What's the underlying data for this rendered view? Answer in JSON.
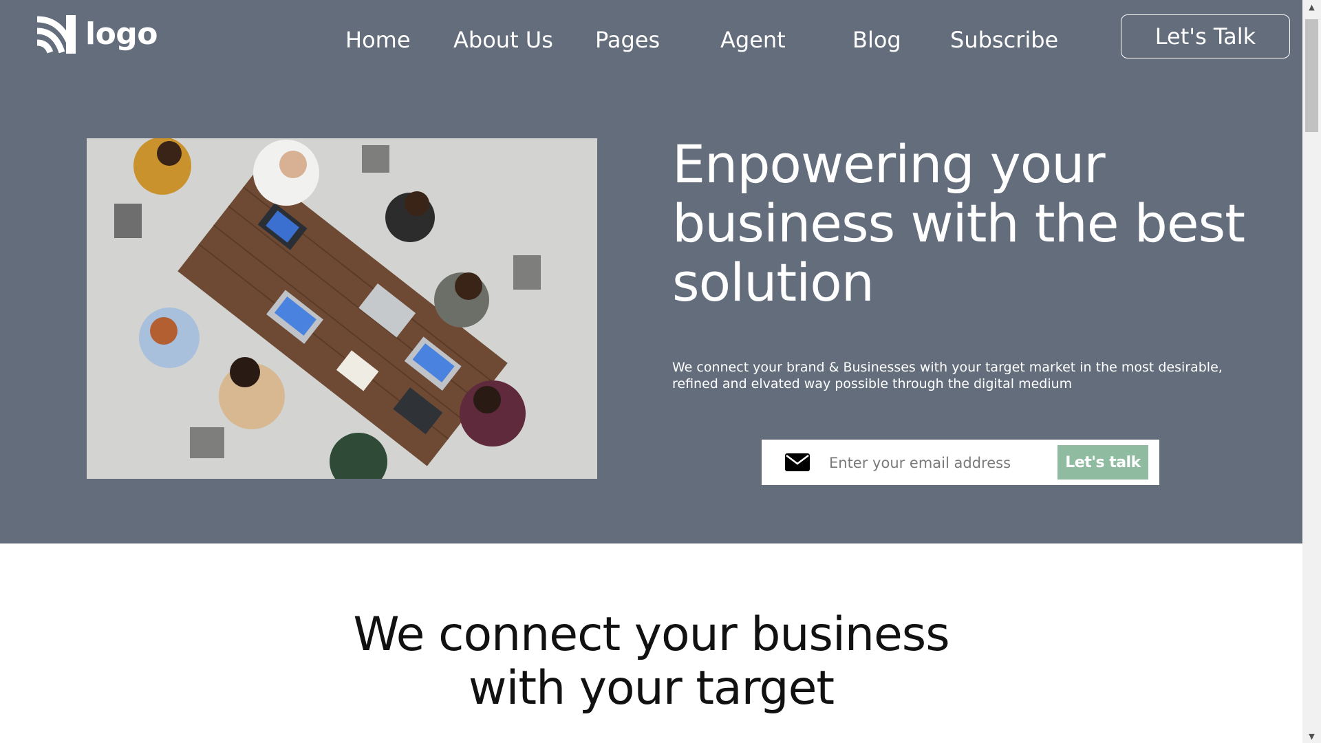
{
  "header": {
    "logo_text": "logo",
    "nav": [
      "Home",
      "About Us",
      "Pages",
      "Agent",
      "Blog",
      "Subscribe"
    ],
    "cta_label": "Let's Talk"
  },
  "hero": {
    "image_icon": "meeting-photo",
    "title": "Enpowering your business with the best solution",
    "subtitle": "We connect your brand & Businesses with your target market in the most desirable, refined and elvated way possible through the digital medium",
    "email_placeholder": "Enter your email address",
    "email_value": "",
    "submit_label": "Let's talk"
  },
  "section": {
    "title_line1": "We connect your business",
    "title_line2": "with your target"
  },
  "colors": {
    "hero_bg": "#636d7b",
    "accent": "#8fbba0",
    "text_light": "#ffffff",
    "text_dark": "#111111"
  }
}
